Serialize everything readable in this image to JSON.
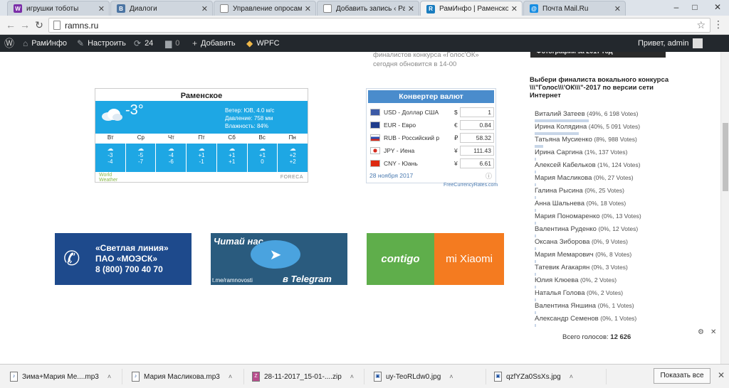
{
  "browser": {
    "tabs": [
      {
        "title": "игрушки тоботы",
        "icon": "W",
        "color": "#7b2ea8"
      },
      {
        "title": "Диалоги",
        "icon": "VK",
        "color": "#4c75a3"
      },
      {
        "title": "Управление опросами",
        "icon": "doc",
        "color": "#888888"
      },
      {
        "title": "Добавить запись ‹ Рам",
        "icon": "doc",
        "color": "#888888"
      },
      {
        "title": "РамИнфо | Раменское и",
        "icon": "R",
        "color": "#1a7dbf"
      },
      {
        "title": "Почта Mail.Ru",
        "icon": "@",
        "color": "#168de2"
      }
    ],
    "url": "ramns.ru",
    "window_controls": [
      "–",
      "□",
      "✕"
    ]
  },
  "wpbar": {
    "site": "РамИнфо",
    "customize": "Настроить",
    "updates": "24",
    "comments": "0",
    "add": "Добавить",
    "wpfc": "WPFC",
    "greeting": "Привет, admin"
  },
  "news_snippet": [
    "финалистов конкурса «Голос'ОК»",
    "сегодня обновится в 14-00"
  ],
  "weather": {
    "city": "Раменское",
    "temp": "-3°",
    "wind": "Ветер: ЮВ, 4.0 м/с",
    "pressure": "Давление: 758 мм",
    "humidity": "Влажность: 84%",
    "days": [
      "Вт",
      "Ср",
      "Чт",
      "Пт",
      "Сб",
      "Вс",
      "Пн"
    ],
    "highs": [
      "-3",
      "-5",
      "-4",
      "+1",
      "+1",
      "+1",
      "+2"
    ],
    "lows": [
      "-4",
      "-7",
      "-6",
      "-1",
      "+1",
      "0",
      "+2"
    ],
    "brand_left": "World Weather",
    "brand_right": "FORECA"
  },
  "converter": {
    "title": "Конвертер валют",
    "rows": [
      {
        "name": "USD - Доллар США",
        "sym": "$",
        "val": "1",
        "flag": "#3c5aa6"
      },
      {
        "name": "EUR - Евро",
        "sym": "€",
        "val": "0.84",
        "flag": "#1f3c8c"
      },
      {
        "name": "RUB - Российский р",
        "sym": "₽",
        "val": "58.32",
        "flag": "#d52b1e"
      },
      {
        "name": "JPY - Иена",
        "sym": "¥",
        "val": "111.43",
        "flag": "#ffffff"
      },
      {
        "name": "CNY - Юань",
        "sym": "¥",
        "val": "6.61",
        "flag": "#de2910"
      }
    ],
    "date": "28 ноября 2017",
    "footer": "FreeCurrencyRates.com"
  },
  "banners": {
    "b1": [
      "«Светлая линия»",
      "ПАО «МОЭСК»",
      "8 (800) 700 40 70"
    ],
    "b2_top": "Читай нас",
    "b2_link": "t.me/ramnovosti",
    "b2_bottom": "в Telegram",
    "b3_left": "contigo",
    "b3_right": "mi Xiaomi"
  },
  "sidebar": {
    "photo_caption": "Фотографии за 2017 год",
    "poll_question": "Выбери финалиста вокального конкурса \\\\\\\"Голос\\\\\\'ОК\\\\\\\"-2017 по версии сети Интернет",
    "options": [
      {
        "name": "Виталий Затеев",
        "votes": "(49%, 6 198 Votes)",
        "pct": 49
      },
      {
        "name": "Ирина Колядина",
        "votes": "(40%, 5 091 Votes)",
        "pct": 40
      },
      {
        "name": "Татьяна Мусиенко",
        "votes": "(8%, 988 Votes)",
        "pct": 8
      },
      {
        "name": "Ирина Саргина",
        "votes": "(1%, 137 Votes)",
        "pct": 1
      },
      {
        "name": "Алексей Кабельков",
        "votes": "(1%, 124 Votes)",
        "pct": 1
      },
      {
        "name": "Мария Масликова",
        "votes": "(0%, 27 Votes)",
        "pct": 0
      },
      {
        "name": "Галина Рысина",
        "votes": "(0%, 25 Votes)",
        "pct": 0
      },
      {
        "name": "Анна Шальнева",
        "votes": "(0%, 18 Votes)",
        "pct": 0
      },
      {
        "name": "Мария Пономаренко",
        "votes": "(0%, 13 Votes)",
        "pct": 0
      },
      {
        "name": "Валентина Руденко",
        "votes": "(0%, 12 Votes)",
        "pct": 0
      },
      {
        "name": "Оксана Зиборова",
        "votes": "(0%, 9 Votes)",
        "pct": 0
      },
      {
        "name": "Мария Мемарович",
        "votes": "(0%, 8 Votes)",
        "pct": 0
      },
      {
        "name": "Татевик Агакарян",
        "votes": "(0%, 3 Votes)",
        "pct": 0
      },
      {
        "name": "Юлия Клюева",
        "votes": "(0%, 2 Votes)",
        "pct": 0
      },
      {
        "name": "Наталья Голова",
        "votes": "(0%, 2 Votes)",
        "pct": 0
      },
      {
        "name": "Валентина Яншина",
        "votes": "(0%, 1 Votes)",
        "pct": 0
      },
      {
        "name": "Александр Семенов",
        "votes": "(0%, 1 Votes)",
        "pct": 0
      }
    ],
    "total_label": "Всего голосов:",
    "total_value": "12 626"
  },
  "downloads": {
    "items": [
      {
        "name": "Зима+Мария Ме....mp3"
      },
      {
        "name": "Мария Масликова.mp3"
      },
      {
        "name": "28-11-2017_15-01-....zip"
      },
      {
        "name": "uy-TeoRLdw0.jpg"
      },
      {
        "name": "qzfYZa0SsXs.jpg"
      }
    ],
    "show_all": "Показать все"
  }
}
